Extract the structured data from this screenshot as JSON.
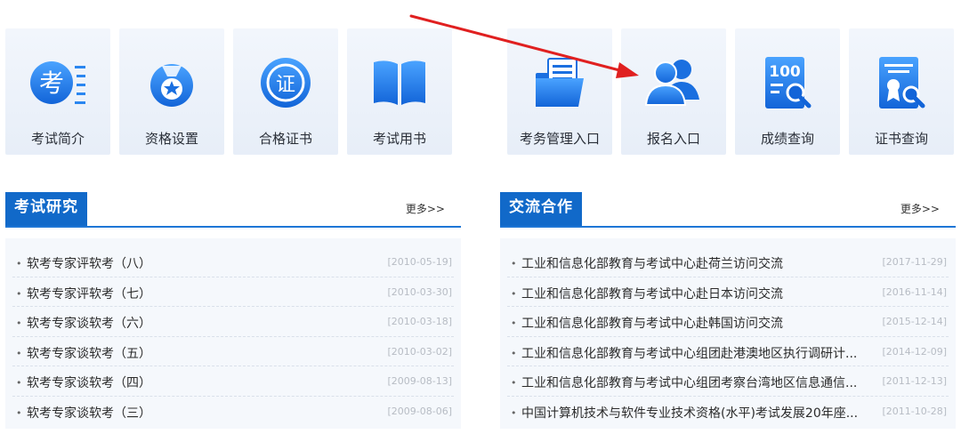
{
  "tiles": [
    {
      "label": "考试简介",
      "icon": "exam-intro-icon",
      "glyph": "考"
    },
    {
      "label": "资格设置",
      "icon": "medal-icon"
    },
    {
      "label": "合格证书",
      "icon": "certificate-icon",
      "glyph": "证"
    },
    {
      "label": "考试用书",
      "icon": "book-icon"
    },
    {
      "label": "考务管理入口",
      "icon": "folder-document-icon"
    },
    {
      "label": "报名入口",
      "icon": "users-icon"
    },
    {
      "label": "成绩查询",
      "icon": "score-search-icon",
      "glyph": "100"
    },
    {
      "label": "证书查询",
      "icon": "certificate-search-icon"
    }
  ],
  "research": {
    "title": "考试研究",
    "more": "更多>>",
    "items": [
      {
        "title": "软考专家评软考（八）",
        "date": "[2010-05-19]"
      },
      {
        "title": "软考专家评软考（七）",
        "date": "[2010-03-30]"
      },
      {
        "title": "软考专家谈软考（六）",
        "date": "[2010-03-18]"
      },
      {
        "title": "软考专家谈软考（五）",
        "date": "[2010-03-02]"
      },
      {
        "title": "软考专家谈软考（四）",
        "date": "[2009-08-13]"
      },
      {
        "title": "软考专家谈软考（三）",
        "date": "[2009-08-06]"
      }
    ]
  },
  "exchange": {
    "title": "交流合作",
    "more": "更多>>",
    "items": [
      {
        "title": "工业和信息化部教育与考试中心赴荷兰访问交流",
        "date": "[2017-11-29]"
      },
      {
        "title": "工业和信息化部教育与考试中心赴日本访问交流",
        "date": "[2016-11-14]"
      },
      {
        "title": "工业和信息化部教育与考试中心赴韩国访问交流",
        "date": "[2015-12-14]"
      },
      {
        "title": "工业和信息化部教育与考试中心组团赴港澳地区执行调研计...",
        "date": "[2014-12-09]"
      },
      {
        "title": "工业和信息化部教育与考试中心组团考察台湾地区信息通信...",
        "date": "[2011-12-13]"
      },
      {
        "title": "中国计算机技术与软件专业技术资格(水平)考试发展20年座...",
        "date": "[2011-10-28]"
      }
    ]
  },
  "colors": {
    "primary": "#1169c9",
    "accent_blue": "#2a86f0",
    "arrow": "#e02020"
  }
}
